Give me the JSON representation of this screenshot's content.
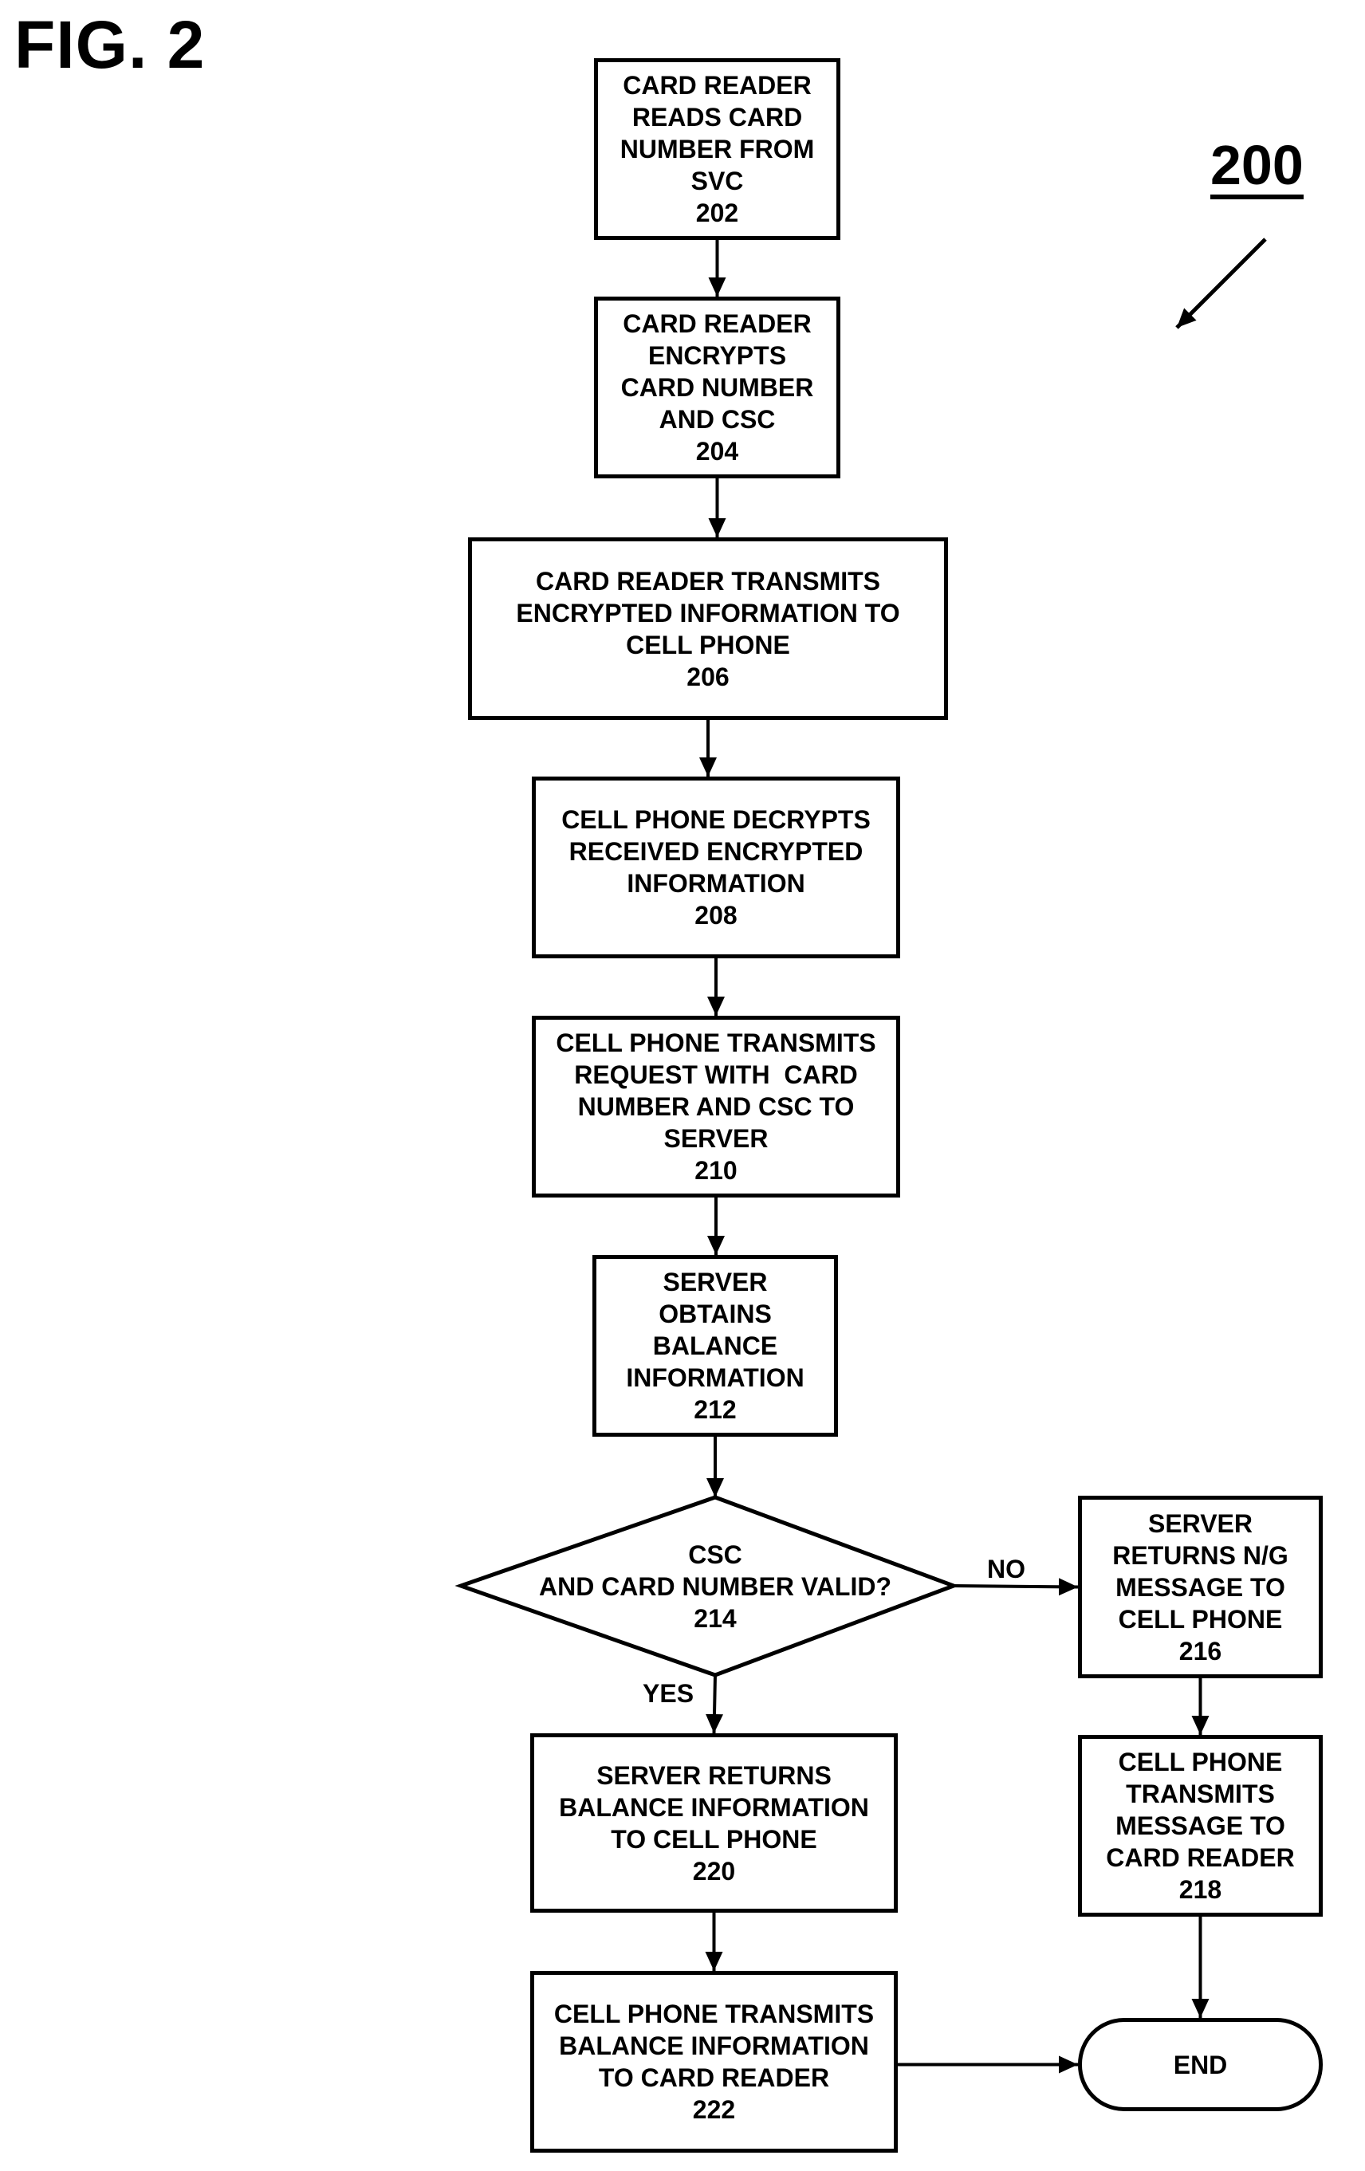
{
  "figure": {
    "title": "FIG. 2",
    "reference_numeral": "200"
  },
  "nodes": [
    {
      "id": "202",
      "type": "process",
      "lines": [
        "CARD READER",
        "READS CARD",
        "NUMBER FROM",
        "SVC",
        "202"
      ]
    },
    {
      "id": "204",
      "type": "process",
      "lines": [
        "CARD READER",
        "ENCRYPTS",
        "CARD NUMBER",
        "AND CSC",
        "204"
      ]
    },
    {
      "id": "206",
      "type": "process",
      "lines": [
        "CARD READER TRANSMITS",
        "ENCRYPTED INFORMATION TO",
        "CELL PHONE",
        "206"
      ]
    },
    {
      "id": "208",
      "type": "process",
      "lines": [
        "CELL PHONE DECRYPTS",
        "RECEIVED ENCRYPTED",
        "INFORMATION",
        "208"
      ]
    },
    {
      "id": "210",
      "type": "process",
      "lines": [
        "CELL PHONE TRANSMITS",
        "REQUEST WITH  CARD",
        "NUMBER AND CSC TO",
        "SERVER",
        "210"
      ]
    },
    {
      "id": "212",
      "type": "process",
      "lines": [
        "SERVER",
        "OBTAINS",
        "BALANCE",
        "INFORMATION",
        "212"
      ]
    },
    {
      "id": "214",
      "type": "decision",
      "lines": [
        "CSC",
        "AND CARD NUMBER VALID?",
        "214"
      ]
    },
    {
      "id": "216",
      "type": "process",
      "lines": [
        "SERVER",
        "RETURNS N/G",
        "MESSAGE TO",
        "CELL PHONE",
        "216"
      ]
    },
    {
      "id": "218",
      "type": "process",
      "lines": [
        "CELL PHONE",
        "TRANSMITS",
        "MESSAGE TO",
        "CARD READER",
        "218"
      ]
    },
    {
      "id": "220",
      "type": "process",
      "lines": [
        "SERVER RETURNS",
        "BALANCE INFORMATION",
        "TO CELL PHONE",
        "220"
      ]
    },
    {
      "id": "222",
      "type": "process",
      "lines": [
        "CELL PHONE TRANSMITS",
        "BALANCE INFORMATION",
        "TO CARD READER",
        "222"
      ]
    },
    {
      "id": "end",
      "type": "terminator",
      "lines": [
        "END"
      ]
    }
  ],
  "edges": [
    {
      "from": "202",
      "to": "204",
      "label": ""
    },
    {
      "from": "204",
      "to": "206",
      "label": ""
    },
    {
      "from": "206",
      "to": "208",
      "label": ""
    },
    {
      "from": "208",
      "to": "210",
      "label": ""
    },
    {
      "from": "210",
      "to": "212",
      "label": ""
    },
    {
      "from": "212",
      "to": "214",
      "label": ""
    },
    {
      "from": "214",
      "to": "216",
      "label": "NO"
    },
    {
      "from": "214",
      "to": "220",
      "label": "YES"
    },
    {
      "from": "216",
      "to": "218",
      "label": ""
    },
    {
      "from": "218",
      "to": "end",
      "label": ""
    },
    {
      "from": "220",
      "to": "222",
      "label": ""
    },
    {
      "from": "222",
      "to": "end",
      "label": ""
    }
  ],
  "colors": {
    "stroke": "#000000",
    "background": "#ffffff"
  }
}
